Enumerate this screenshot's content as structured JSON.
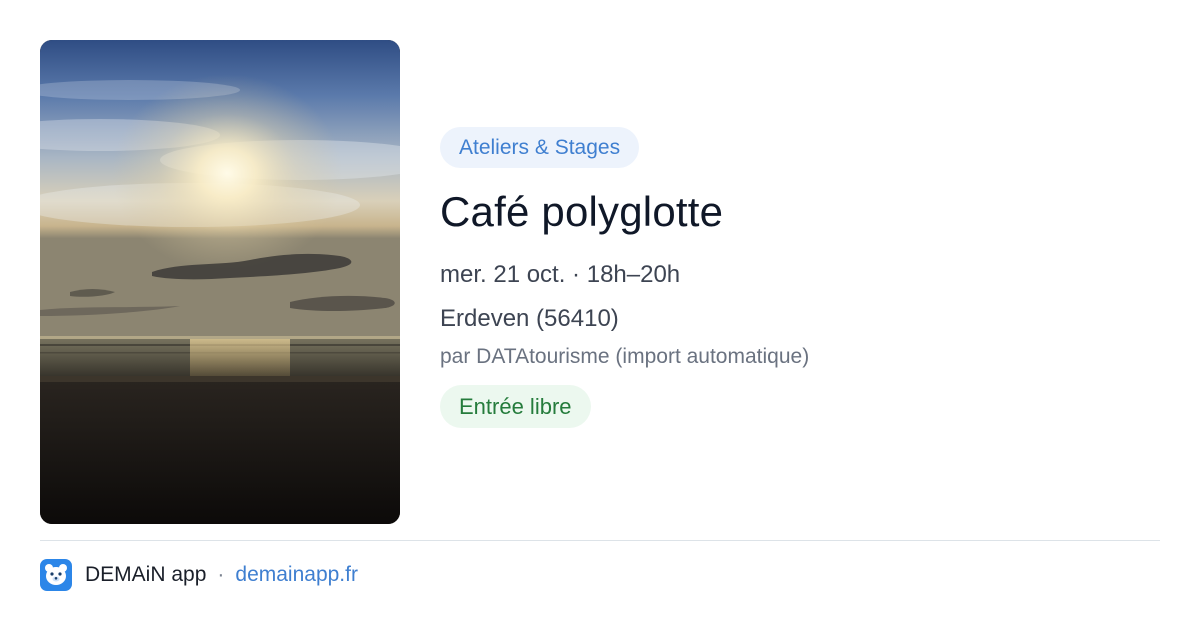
{
  "event": {
    "category": "Ateliers & Stages",
    "title": "Café polyglotte",
    "datetime": "mer. 21 oct. · 18h–20h",
    "location": "Erdeven (56410)",
    "source": "par DATAtourisme (import automatique)",
    "price": "Entrée libre"
  },
  "footer": {
    "app_name": "DEMAiN app",
    "separator": "·",
    "url": "demainapp.fr"
  },
  "colors": {
    "accent": "#3f7fd0",
    "title": "#101828",
    "price_text": "#257c3c",
    "price_bg": "#ecf8ef",
    "category_bg": "#edf3fc",
    "logo_bg": "#2c86e8"
  },
  "icons": {
    "app_logo": "bear-face-icon"
  }
}
